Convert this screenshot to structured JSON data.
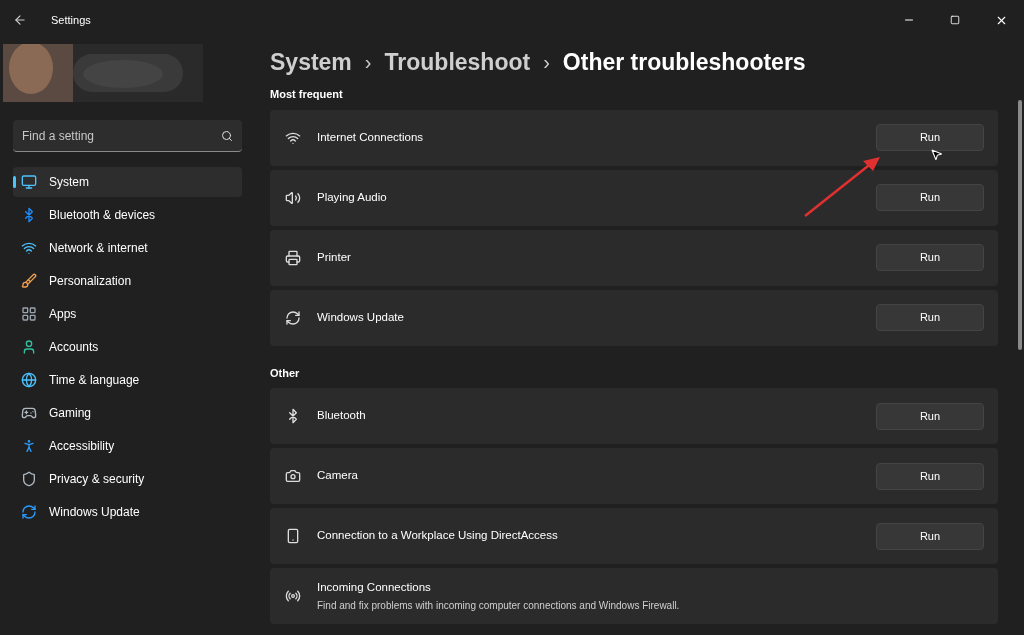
{
  "window": {
    "title": "Settings"
  },
  "search": {
    "placeholder": "Find a setting"
  },
  "sidebar": {
    "items": [
      {
        "label": "System",
        "selected": true
      },
      {
        "label": "Bluetooth & devices",
        "selected": false
      },
      {
        "label": "Network & internet",
        "selected": false
      },
      {
        "label": "Personalization",
        "selected": false
      },
      {
        "label": "Apps",
        "selected": false
      },
      {
        "label": "Accounts",
        "selected": false
      },
      {
        "label": "Time & language",
        "selected": false
      },
      {
        "label": "Gaming",
        "selected": false
      },
      {
        "label": "Accessibility",
        "selected": false
      },
      {
        "label": "Privacy & security",
        "selected": false
      },
      {
        "label": "Windows Update",
        "selected": false
      }
    ]
  },
  "breadcrumb": [
    {
      "label": "System",
      "separator": "›"
    },
    {
      "label": "Troubleshoot",
      "separator": "›"
    },
    {
      "label": "Other troubleshooters"
    }
  ],
  "sections": [
    {
      "title": "Most frequent",
      "items": [
        {
          "label": "Internet Connections",
          "button": "Run"
        },
        {
          "label": "Playing Audio",
          "button": "Run"
        },
        {
          "label": "Printer",
          "button": "Run"
        },
        {
          "label": "Windows Update",
          "button": "Run"
        }
      ]
    },
    {
      "title": "Other",
      "items": [
        {
          "label": "Bluetooth",
          "button": "Run"
        },
        {
          "label": "Camera",
          "button": "Run"
        },
        {
          "label": "Connection to a Workplace Using DirectAccess",
          "button": "Run"
        },
        {
          "label": "Incoming Connections",
          "description": "Find and fix problems with incoming computer connections and Windows Firewall."
        }
      ]
    }
  ]
}
